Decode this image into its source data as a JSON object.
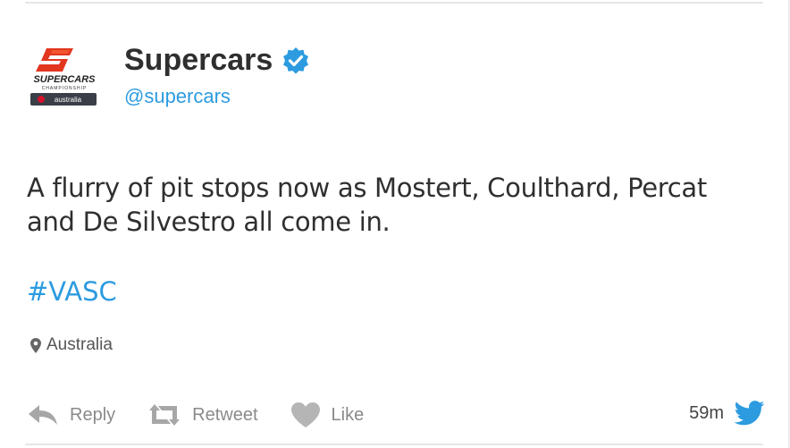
{
  "account": {
    "display_name": "Supercars",
    "handle": "@supercars",
    "verified": true,
    "logo_text": "SUPERCARS",
    "logo_subtext": "CHAMPIONSHIP",
    "logo_sponsor": "australia"
  },
  "tweet": {
    "text": "A flurry of pit stops now as Mostert, Coulthard, Percat and De Silvestro all come in.",
    "hashtag": "#VASC",
    "location": "Australia",
    "time": "59m"
  },
  "actions": {
    "reply_label": "Reply",
    "retweet_label": "Retweet",
    "like_label": "Like"
  },
  "icons": {
    "verified": "verified-badge-icon",
    "location": "map-pin-icon",
    "reply": "reply-arrow-icon",
    "retweet": "retweet-icon",
    "like": "heart-icon",
    "brand": "twitter-bird-icon"
  },
  "colors": {
    "link_blue": "#2c9be0",
    "text_dark": "#2f2f2f",
    "muted": "#8a8a8a",
    "logo_red": "#e2361f"
  }
}
